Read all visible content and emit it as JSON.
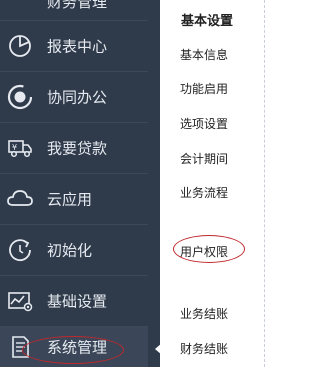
{
  "sidebar": {
    "top_partial_label": "财务管理",
    "items": [
      {
        "label": "报表中心",
        "icon": "pie-chart-icon"
      },
      {
        "label": "协同办公",
        "icon": "sync-circle-icon"
      },
      {
        "label": "我要贷款",
        "icon": "loan-truck-icon"
      },
      {
        "label": "云应用",
        "icon": "cloud-icon"
      },
      {
        "label": "初始化",
        "icon": "refresh-clock-icon"
      },
      {
        "label": "基础设置",
        "icon": "chart-settings-icon"
      },
      {
        "label": "系统管理",
        "icon": "document-list-icon"
      }
    ],
    "active_item": "系统管理",
    "colors": {
      "background": "#2f3a4a",
      "text": "#e6eaf0",
      "highlight": "#c0282d"
    }
  },
  "submenu": {
    "title": "基本设置",
    "items": [
      "基本信息",
      "功能启用",
      "选项设置",
      "会计期间",
      "业务流程",
      "用户权限",
      "业务结账",
      "财务结账"
    ],
    "highlighted_item": "用户权限"
  }
}
